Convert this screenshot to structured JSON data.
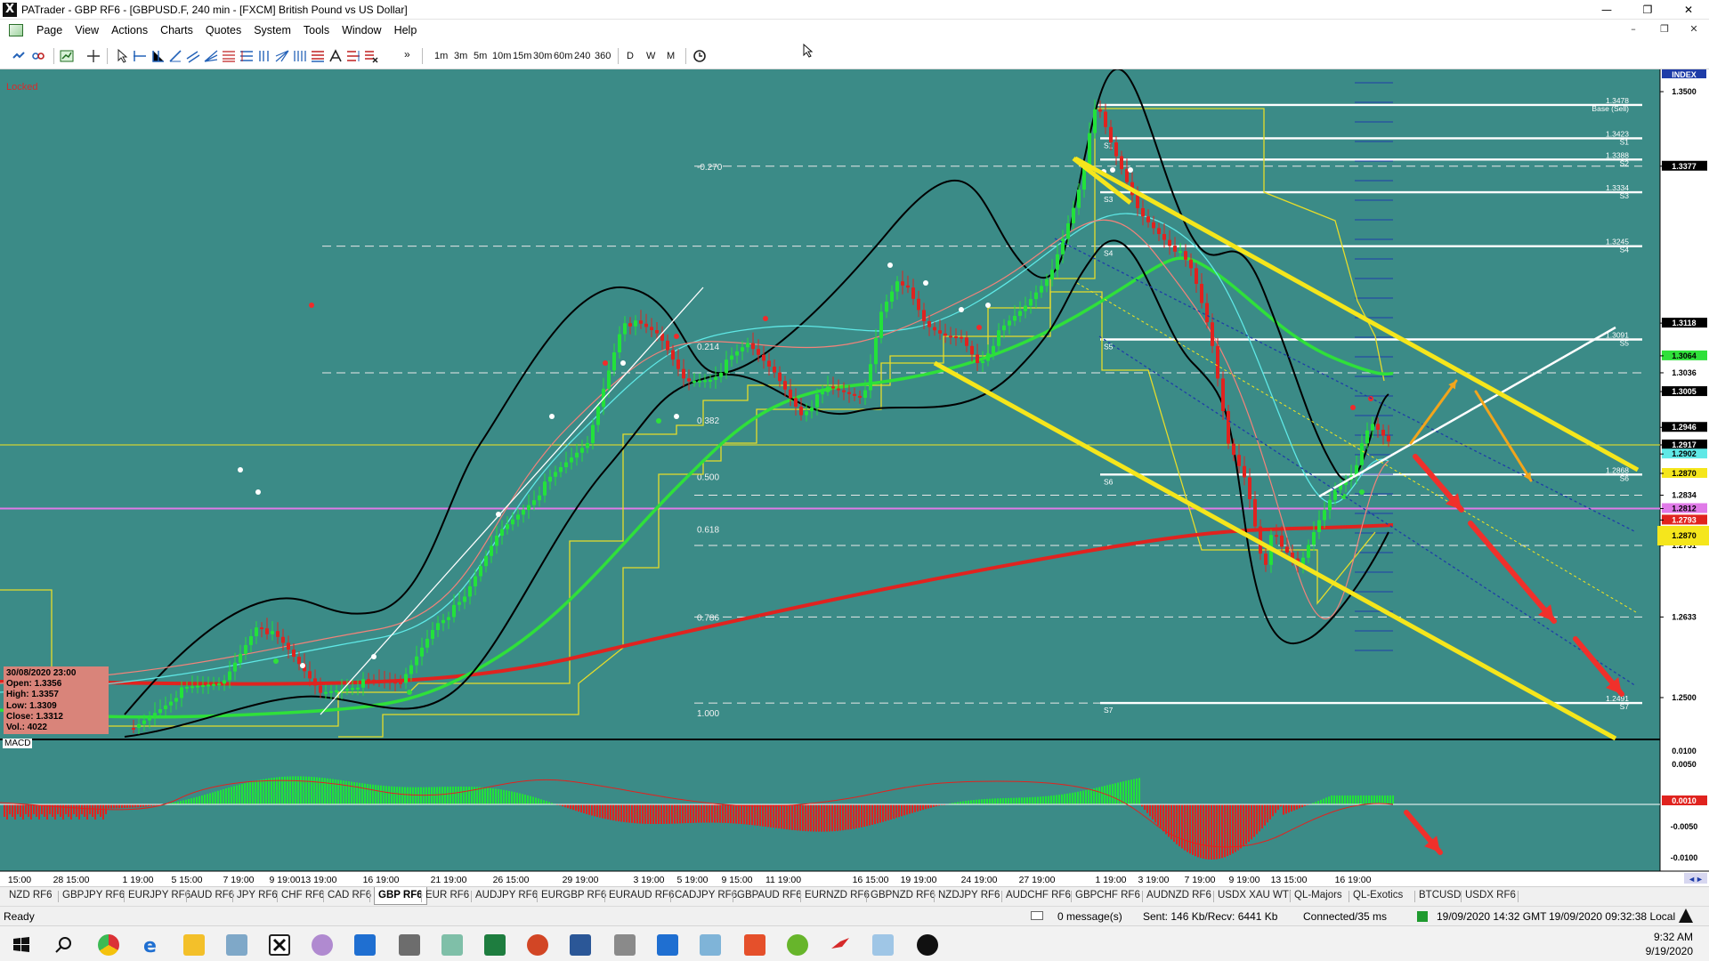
{
  "window": {
    "title": "PATrader - GBP RF6 - [GBPUSD.F, 240 min - [FXCM] British Pound vs US Dollar]",
    "minimize_glyph": "—",
    "maximize_glyph": "❐",
    "close_glyph": "✕"
  },
  "menu": {
    "items": [
      "Page",
      "View",
      "Actions",
      "Charts",
      "Quotes",
      "System",
      "Tools",
      "Window",
      "Help"
    ],
    "mdi_minimize": "–",
    "mdi_restore": "❐",
    "mdi_close": "✕"
  },
  "toolbar": {
    "timeframes": [
      "1m",
      "3m",
      "5m",
      "10m",
      "15m",
      "30m",
      "60m",
      "240",
      "360"
    ],
    "periods": [
      "D",
      "W",
      "M"
    ],
    "more_glyph": "»"
  },
  "chart": {
    "locked_label": "Locked",
    "index_label": "INDEX",
    "macd_label": "MACD",
    "fib_labels": [
      "-0.270",
      "0.214",
      "0.382",
      "0.500",
      "0.618",
      "0.786",
      "1.000"
    ],
    "pivot_labels": [
      "S1",
      "S2",
      "S3",
      "S4",
      "S5",
      "S6",
      "S7"
    ],
    "right_level_labels": [
      {
        "price": "1.3478",
        "tag": "Base (Sell)"
      },
      {
        "price": "1.3423",
        "tag": "S1"
      },
      {
        "price": "1.3388",
        "tag": "S2"
      },
      {
        "price": "1.3334",
        "tag": "S3"
      },
      {
        "price": "1.3245",
        "tag": "S4"
      },
      {
        "price": "1.3091",
        "tag": "S5"
      },
      {
        "price": "1.2868",
        "tag": "S6"
      },
      {
        "price": "1.2491",
        "tag": "S7"
      }
    ],
    "price_axis": [
      "1.3500",
      "1.3377",
      "1.3118",
      "1.3064",
      "1.3036",
      "1.3005",
      "1.2946",
      "1.2917",
      "1.2902",
      "1.2870",
      "1.2834",
      "1.2812",
      "1.2793",
      "1.2763",
      "1.2751",
      "1.2633",
      "1.2500"
    ],
    "macd_axis": [
      "0.0100",
      "0.0050",
      "0.0010",
      "-0.0050",
      "-0.0100"
    ],
    "time_axis": [
      "15:00",
      "28 15:00",
      "1 19:00",
      "5 15:00",
      "7 19:00",
      "9 19:00",
      "13 19:00",
      "16 19:00",
      "21 19:00",
      "26 15:00",
      "29 19:00",
      "3 19:00",
      "5 19:00",
      "9 15:00",
      "11 19:00",
      "16 15:00",
      "19 19:00",
      "24 19:00",
      "27 19:00",
      "1 19:00",
      "3 19:00",
      "7 19:00",
      "9 19:00",
      "13 15:00",
      "16 19:00"
    ],
    "info_box": {
      "date": "30/08/2020 23:00",
      "open": "Open: 1.3356",
      "high": "High: 1.3357",
      "low": "Low: 1.3309",
      "close": "Close: 1.3312",
      "vol": "Vol.: 4022"
    },
    "colors": {
      "background": "#3b8b87",
      "bull": "#22e23a",
      "bear": "#e0231f",
      "channel": "#f5e61c",
      "arrow_red": "#f0302b",
      "arrow_orange": "#f2a51c",
      "ma_green": "#2fe03a",
      "ma_red": "#e0231f"
    }
  },
  "symbol_tabs": [
    "NZD RF6",
    "GBPJPY RF6",
    "EURJPY RF6",
    "AUD RF6",
    "JPY RF6",
    "CHF RF6",
    "CAD RF6",
    "GBP RF6",
    "EUR RF6",
    "AUDJPY RF6",
    "EURGBP RF6",
    "EURAUD RF6",
    "CADJPY RF6",
    "GBPAUD RF6",
    "EURNZD RF6",
    "GBPNZD RF6",
    "NZDJPY RF6",
    "AUDCHF RF6",
    "GBPCHF RF6",
    "AUDNZD RF6",
    "USDX XAU WTI",
    "QL-Majors",
    "QL-Exotics",
    "BTCUSD",
    "USDX RF6"
  ],
  "active_tab": "GBP RF6",
  "status": {
    "ready": "Ready",
    "messages": "0 message(s)",
    "sent": "Sent: 146 Kb/Recv: 6441 Kb",
    "connected": "Connected/35 ms",
    "gmt": "19/09/2020 14:32 GMT",
    "local": "19/09/2020 09:32:38 Local"
  },
  "taskbar": {
    "time": "9:32 AM",
    "date": "9/19/2020"
  }
}
